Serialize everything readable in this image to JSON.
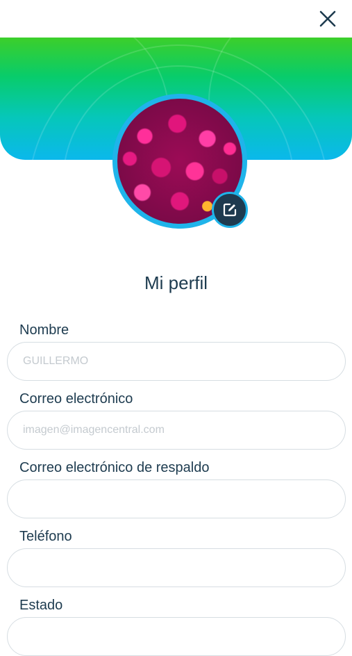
{
  "header": {
    "close_icon": "close-icon"
  },
  "profile": {
    "avatar_alt": "Foto de perfil",
    "edit_icon": "edit-icon",
    "title": "Mi perfil"
  },
  "form": {
    "fields": [
      {
        "label": "Nombre",
        "value": "",
        "placeholder": "GUILLERMO"
      },
      {
        "label": "Correo electrónico",
        "value": "",
        "placeholder": "imagen@imagencentral.com"
      },
      {
        "label": "Correo electrónico de respaldo",
        "value": "",
        "placeholder": ""
      },
      {
        "label": "Teléfono",
        "value": "",
        "placeholder": ""
      },
      {
        "label": "Estado",
        "value": "",
        "placeholder": ""
      }
    ]
  },
  "colors": {
    "primary_text": "#1d3b4f",
    "accent_blue": "#1fb4ea",
    "banner_green": "#3ccf2a",
    "banner_cyan": "#0bb8ec"
  }
}
